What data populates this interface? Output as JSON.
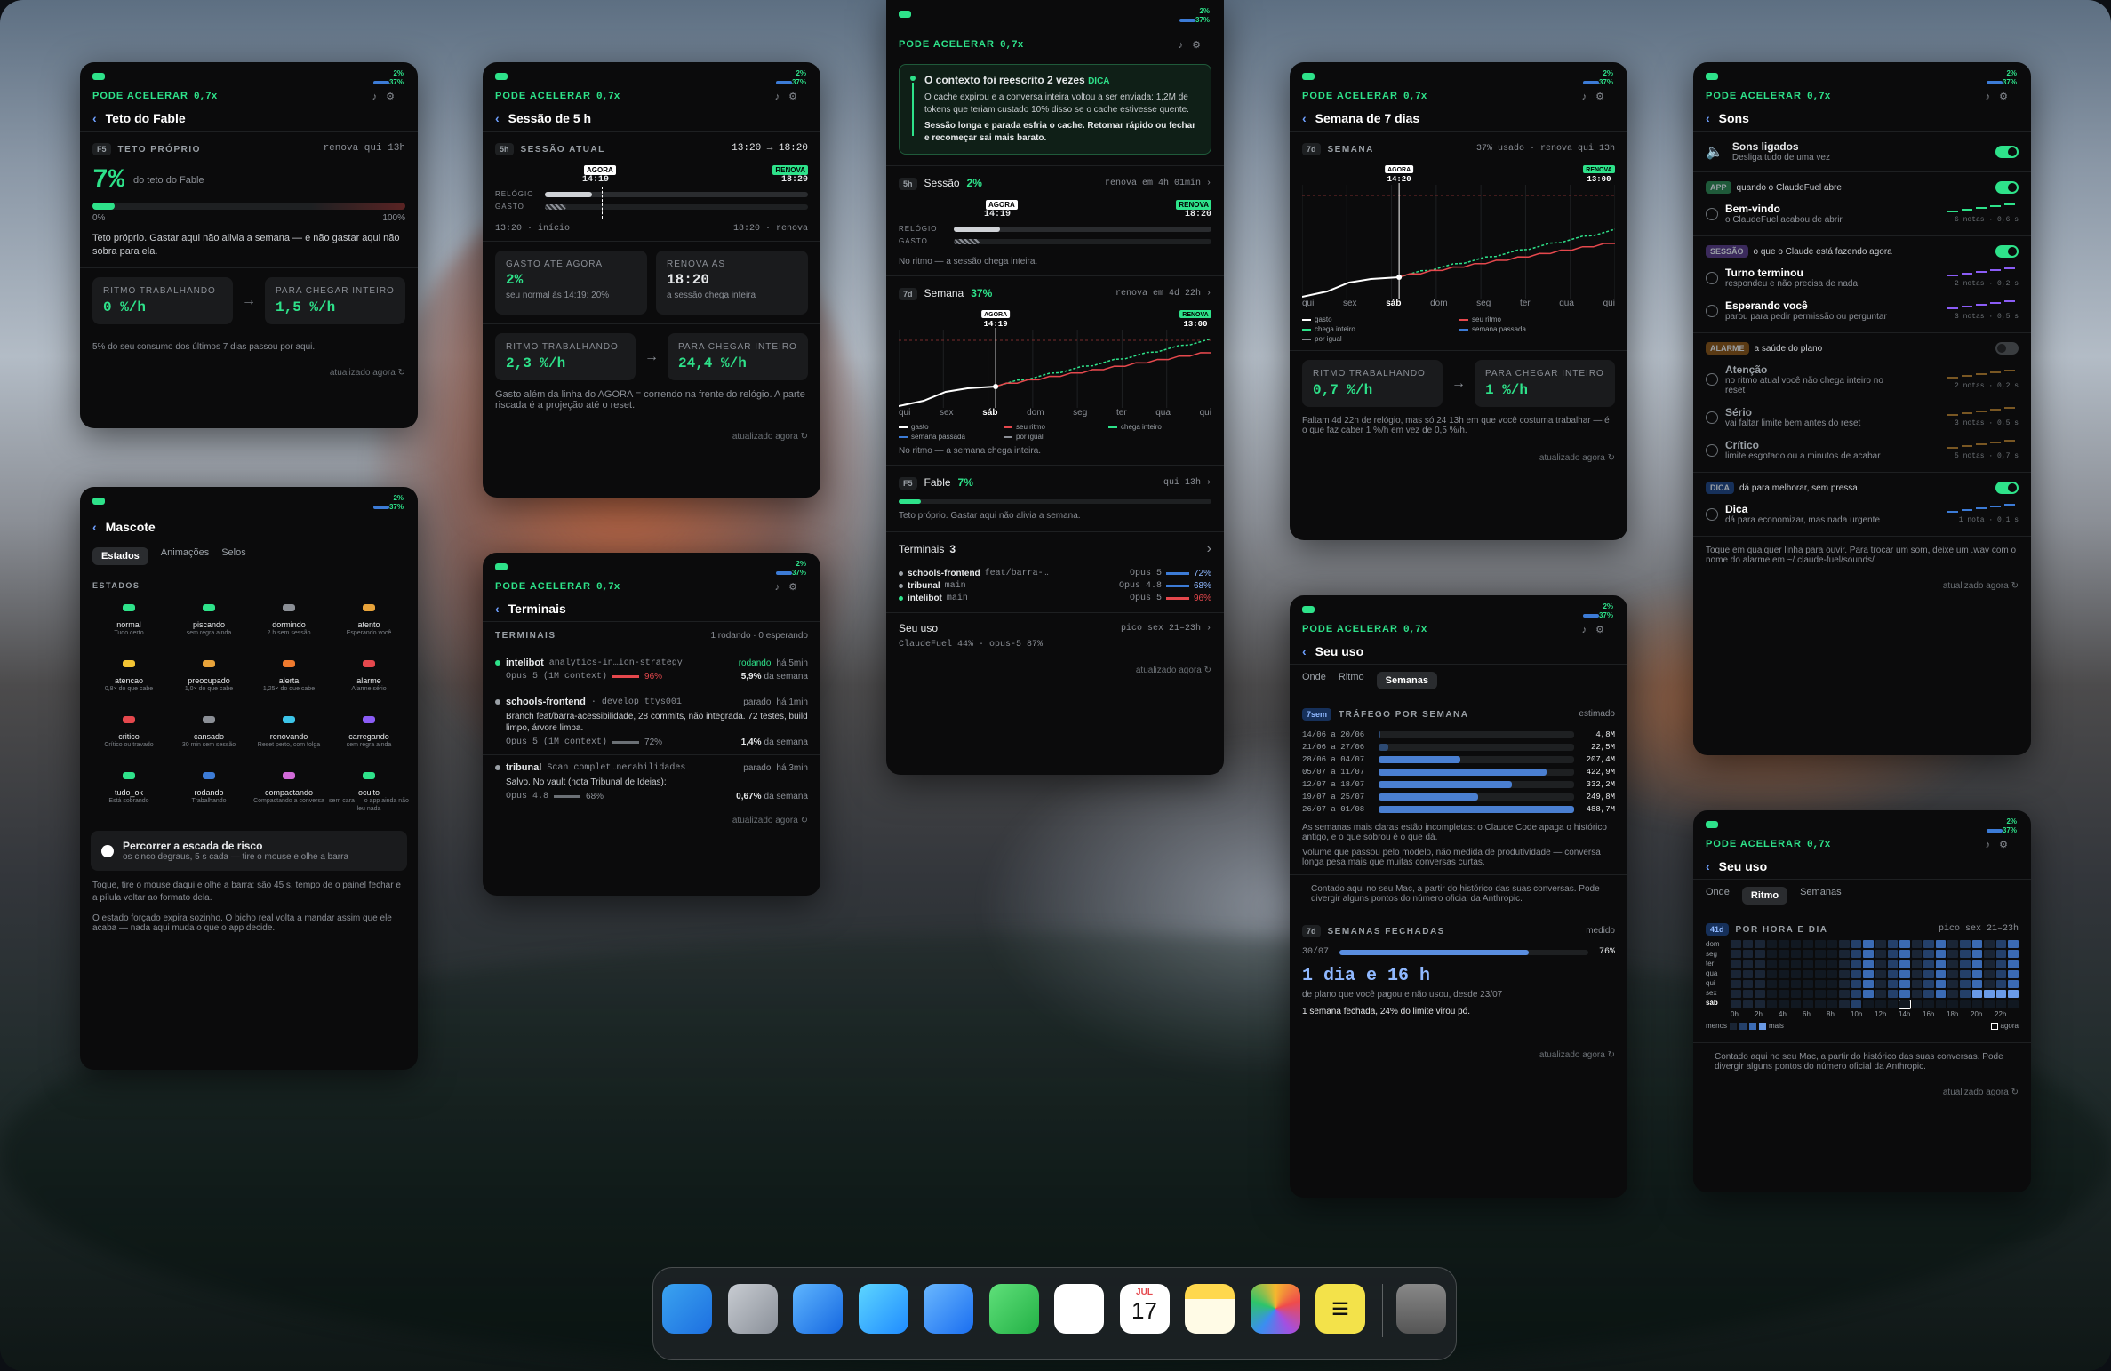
{
  "colors": {
    "accent_green": "#2ee28a",
    "accent_blue": "#3c7bd6",
    "accent_red": "#e5484d",
    "accent_orange": "#e8a33a"
  },
  "common": {
    "accel_label": "PODE ACELERAR",
    "accel_value": "0,7x",
    "stat_top": "2%",
    "stat_bottom": "37%",
    "updated": "atualizado agora"
  },
  "p1": {
    "title": "Teto do Fable",
    "tag": "F5",
    "section": "TETO PRÓPRIO",
    "renew": "renova qui 13h",
    "big": "7%",
    "big_sub": "do teto do Fable",
    "bar_min": "0%",
    "bar_max": "100%",
    "fill_fraction": 0.07,
    "desc": "Teto próprio. Gastar aqui não alivia a semana — e não gastar aqui não sobra para ela.",
    "rate_label": "RITMO TRABALHANDO",
    "rate_value": "0 %/h",
    "need_label": "PARA CHEGAR INTEIRO",
    "need_value": "1,5 %/h",
    "note": "5% do seu consumo dos últimos 7 dias passou por aqui."
  },
  "p2": {
    "title": "Mascote",
    "tabs": [
      "Estados",
      "Animações",
      "Selos"
    ],
    "section": "ESTADOS",
    "states": [
      {
        "name": "normal",
        "sub": "Tudo certo",
        "color": "#2ee28a"
      },
      {
        "name": "piscando",
        "sub": "sem regra ainda",
        "color": "#2ee28a"
      },
      {
        "name": "dormindo",
        "sub": "2 h sem sessão",
        "color": "#8b8f96"
      },
      {
        "name": "atento",
        "sub": "Esperando você",
        "color": "#e8a33a"
      },
      {
        "name": "atencao",
        "sub": "0,8× do que cabe",
        "color": "#f3c433"
      },
      {
        "name": "preocupado",
        "sub": "1,0× do que cabe",
        "color": "#e8a33a"
      },
      {
        "name": "alerta",
        "sub": "1,25× do que cabe",
        "color": "#ef7a2e"
      },
      {
        "name": "alarme",
        "sub": "Alarme sério",
        "color": "#e5484d"
      },
      {
        "name": "critico",
        "sub": "Crítico ou travado",
        "color": "#e5484d"
      },
      {
        "name": "cansado",
        "sub": "30 min sem sessão",
        "color": "#8b8f96"
      },
      {
        "name": "renovando",
        "sub": "Reset perto, com folga",
        "color": "#3cc4e8"
      },
      {
        "name": "carregando",
        "sub": "sem regra ainda",
        "color": "#8b5cf6"
      },
      {
        "name": "tudo_ok",
        "sub": "Está sobrando",
        "color": "#2ee28a"
      },
      {
        "name": "rodando",
        "sub": "Trabalhando",
        "color": "#3c7bd6"
      },
      {
        "name": "compactando",
        "sub": "Compactando a conversa",
        "color": "#d16ad8"
      },
      {
        "name": "oculto",
        "sub": "sem cara — o app ainda não leu nada",
        "color": "#2ee28a"
      }
    ],
    "risk_title": "Percorrer a escada de risco",
    "risk_sub": "os cinco degraus, 5 s cada — tire o mouse e olhe a barra",
    "help1": "Toque, tire o mouse daqui e olhe a barra: são 45 s, tempo de o painel fechar e a pílula voltar ao formato dela.",
    "help2": "O estado forçado expira sozinho. O bicho real volta a mandar assim que ele acaba — nada aqui muda o que o app decide."
  },
  "p3": {
    "title": "Sessão de 5 h",
    "tag": "5h",
    "section": "SESSÃO ATUAL",
    "range": "13:20 → 18:20",
    "now_label": "AGORA",
    "now_time": "14:19",
    "renew_label": "RENOVA",
    "renew_time": "18:20",
    "clock_label": "RELÓGIO",
    "spent_label": "GASTO",
    "start": "13:20 · início",
    "end": "18:20 · renova",
    "spent_so_far_label": "GASTO ATÉ AGORA",
    "spent_so_far": "2%",
    "spent_note": "seu normal às 14:19: 20%",
    "renews_at_label": "RENOVA ÀS",
    "renews_at": "18:20",
    "renews_note": "a sessão chega inteira",
    "rate_label": "RITMO TRABALHANDO",
    "rate_value": "2,3 %/h",
    "need_label": "PARA CHEGAR INTEIRO",
    "need_value": "24,4 %/h",
    "note": "Gasto além da linha do AGORA = correndo na frente do relógio. A parte riscada é a projeção até o reset."
  },
  "p4": {
    "title": "Terminais",
    "section": "TERMINAIS",
    "summary": "1 rodando · 0 esperando",
    "items": [
      {
        "name": "intelibot",
        "branch": "analytics-in…ion-strategy",
        "status": "rodando",
        "since": "há 5min",
        "model": "Opus 5 (1M context)",
        "pct": "96%",
        "week": "5,9%",
        "week_suffix": "da semana",
        "desc": "",
        "dot": "#2ee28a"
      },
      {
        "name": "schools-frontend",
        "branch": "· develop ttys001",
        "status": "parado",
        "since": "há 1min",
        "model": "Opus 5 (1M context)",
        "pct": "72%",
        "week": "1,4%",
        "week_suffix": "da semana",
        "desc": "Branch feat/barra-acessibilidade, 28 commits, não integrada. 72 testes, build limpo, árvore limpa.",
        "dot": "#9aa0a6"
      },
      {
        "name": "tribunal",
        "branch": "Scan complet…nerabilidades",
        "status": "parado",
        "since": "há 3min",
        "model": "Opus 4.8",
        "pct": "68%",
        "week": "0,67%",
        "week_suffix": "da semana",
        "desc": "Salvo. No vault (nota Tribunal de Ideias):",
        "dot": "#9aa0a6"
      }
    ]
  },
  "p5": {
    "tip_title": "O contexto foi reescrito 2 vezes",
    "tip_tag": "DICA",
    "tip_body": "O cache expirou e a conversa inteira voltou a ser enviada: 1,2M de tokens que teriam custado 10% disso se o cache estivesse quente.",
    "tip_bold": "Sessão longa e parada esfria o cache. Retomar rápido ou fechar e recomeçar sai mais barato.",
    "session_tag": "5h",
    "session_label": "Sessão",
    "session_pct": "2%",
    "session_renew": "renova em 4h 01min",
    "now_label": "AGORA",
    "now_time": "14:19",
    "renew_label": "RENOVA",
    "renew_time": "18:20",
    "clock_label": "RELÓGIO",
    "spent_label": "GASTO",
    "session_note": "No ritmo — a sessão chega inteira.",
    "week_tag": "7d",
    "week_label": "Semana",
    "week_pct": "37%",
    "week_renew": "renova em 4d 22h",
    "week_renew_time": "13:00",
    "days": [
      "qui",
      "sex",
      "sáb",
      "dom",
      "seg",
      "ter",
      "qua",
      "qui"
    ],
    "legend": [
      "gasto",
      "seu ritmo",
      "chega inteiro",
      "semana passada",
      "por igual"
    ],
    "week_note": "No ritmo — a semana chega inteira.",
    "fable_tag": "F5",
    "fable_label": "Fable",
    "fable_pct": "7%",
    "fable_renew": "qui 13h",
    "fable_note": "Teto próprio. Gastar aqui não alivia a semana.",
    "terminals_label": "Terminais",
    "terminals_count": "3",
    "terminals": [
      {
        "name": "schools-frontend",
        "branch": "feat/barra-…",
        "model": "Opus 5",
        "pct": "72%",
        "color": "#3c7bd6"
      },
      {
        "name": "tribunal",
        "branch": "main",
        "model": "Opus 4.8",
        "pct": "68%",
        "color": "#3c7bd6"
      },
      {
        "name": "intelibot",
        "branch": "main",
        "model": "Opus 5",
        "pct": "96%",
        "color": "#e5484d"
      }
    ],
    "usage_label": "Seu uso",
    "usage_peak": "pico sex 21–23h",
    "usage_sub": "ClaudeFuel 44% · opus-5 87%"
  },
  "p6": {
    "title": "Semana de 7 dias",
    "tag": "7d",
    "section": "SEMANA",
    "summary": "37% usado · renova qui 13h",
    "now_label": "AGORA",
    "now_time": "14:20",
    "renew_label": "RENOVA",
    "renew_time": "13:00",
    "days": [
      "qui",
      "sex",
      "sáb",
      "dom",
      "seg",
      "ter",
      "qua",
      "qui"
    ],
    "legend": [
      "gasto",
      "seu ritmo",
      "chega inteiro",
      "semana passada",
      "por igual"
    ],
    "rate_label": "RITMO TRABALHANDO",
    "rate_value": "0,7 %/h",
    "need_label": "PARA CHEGAR INTEIRO",
    "need_value": "1 %/h",
    "note": "Faltam 4d 22h de relógio, mas só 24 13h em que você costuma trabalhar — é o que faz caber 1 %/h em vez de 0,5 %/h."
  },
  "p7": {
    "title": "Seu uso",
    "tabs": [
      "Onde",
      "Ritmo",
      "Semanas"
    ],
    "tag": "7sem",
    "section": "TRÁFEGO POR SEMANA",
    "section_right": "estimado",
    "weeks": [
      {
        "label": "14/06 a 20/06",
        "value": "4,8M",
        "frac": 0.01
      },
      {
        "label": "21/06 a 27/06",
        "value": "22,5M",
        "frac": 0.05
      },
      {
        "label": "28/06 a 04/07",
        "value": "207,4M",
        "frac": 0.42
      },
      {
        "label": "05/07 a 11/07",
        "value": "422,9M",
        "frac": 0.86
      },
      {
        "label": "12/07 a 18/07",
        "value": "332,2M",
        "frac": 0.68
      },
      {
        "label": "19/07 a 25/07",
        "value": "249,8M",
        "frac": 0.51
      },
      {
        "label": "26/07 a 01/08",
        "value": "488,7M",
        "frac": 1.0
      }
    ],
    "note1": "As semanas mais claras estão incompletas: o Claude Code apaga o histórico antigo, e o que sobrou é o que dá.",
    "note2": "Volume que passou pelo modelo, não medida de produtividade — conversa longa pesa mais que muitas conversas curtas.",
    "note3": "Contado aqui no seu Mac, a partir do histórico das suas conversas. Pode divergir alguns pontos do número oficial da Anthropic.",
    "closed_tag": "7d",
    "closed_label": "SEMANAS FECHADAS",
    "closed_right": "medido",
    "closed_week": "30/07",
    "closed_pct": "76%",
    "closed_frac": 0.76,
    "big": "1 dia e 16 h",
    "big_sub": "de plano que você pagou e não usou, desde 23/07",
    "foot": "1 semana fechada, 24% do limite virou pó."
  },
  "p8": {
    "title": "Sons",
    "master_title": "Sons ligados",
    "master_sub": "Desliga tudo de uma vez",
    "groups": [
      {
        "tag": "APP",
        "title": "quando o ClaudeFuel abre",
        "on": true,
        "items": [
          {
            "name": "Bem-vindo",
            "sub": "o ClaudeFuel acabou de abrir",
            "meta": "6 notas · 0,6 s",
            "color": "#2ee28a"
          }
        ]
      },
      {
        "tag": "SESSÃO",
        "title": "o que o Claude está fazendo agora",
        "on": true,
        "items": [
          {
            "name": "Turno terminou",
            "sub": "respondeu e não precisa de nada",
            "meta": "2 notas · 0,2 s",
            "color": "#8b5cf6"
          },
          {
            "name": "Esperando você",
            "sub": "parou para pedir permissão ou perguntar",
            "meta": "3 notas · 0,5 s",
            "color": "#8b5cf6"
          }
        ]
      },
      {
        "tag": "ALARME",
        "title": "a saúde do plano",
        "on": false,
        "items": [
          {
            "name": "Atenção",
            "sub": "no ritmo atual você não chega inteiro no reset",
            "meta": "2 notas · 0,2 s",
            "color": "#e8a33a"
          },
          {
            "name": "Sério",
            "sub": "vai faltar limite bem antes do reset",
            "meta": "3 notas · 0,5 s",
            "color": "#e8a33a"
          },
          {
            "name": "Crítico",
            "sub": "limite esgotado ou a minutos de acabar",
            "meta": "5 notas · 0,7 s",
            "color": "#e8a33a"
          }
        ]
      },
      {
        "tag": "DICA",
        "title": "dá para melhorar, sem pressa",
        "on": true,
        "items": [
          {
            "name": "Dica",
            "sub": "dá para economizar, mas nada urgente",
            "meta": "1 nota · 0,1 s",
            "color": "#3c7bd6"
          }
        ]
      }
    ],
    "note": "Toque em qualquer linha para ouvir. Para trocar um som, deixe um .wav com o nome do alarme em ~/.claude-fuel/sounds/"
  },
  "p9": {
    "title": "Seu uso",
    "tabs": [
      "Onde",
      "Ritmo",
      "Semanas"
    ],
    "tag": "41d",
    "section": "POR HORA E DIA",
    "peak": "pico sex 21–23h",
    "day_labels": [
      "dom",
      "seg",
      "ter",
      "qua",
      "qui",
      "sex",
      "sáb"
    ],
    "hour_labels": [
      "0h",
      "2h",
      "4h",
      "6h",
      "8h",
      "10h",
      "12h",
      "14h",
      "16h",
      "18h",
      "20h",
      "22h"
    ],
    "less": "menos",
    "more": "mais",
    "now": "agora",
    "note": "Contado aqui no seu Mac, a partir do histórico das suas conversas. Pode divergir alguns pontos do número oficial da Anthropic."
  },
  "dock": {
    "apps": [
      "finder-icon",
      "launchpad-icon",
      "safari-icon",
      "messages-icon",
      "mail-icon",
      "facetime-icon",
      "reminders-icon",
      "calendar-icon",
      "notes-icon",
      "photos-icon",
      "claudefuel-icon",
      "trash-icon"
    ],
    "cal_month": "JUL",
    "cal_day": "17"
  }
}
